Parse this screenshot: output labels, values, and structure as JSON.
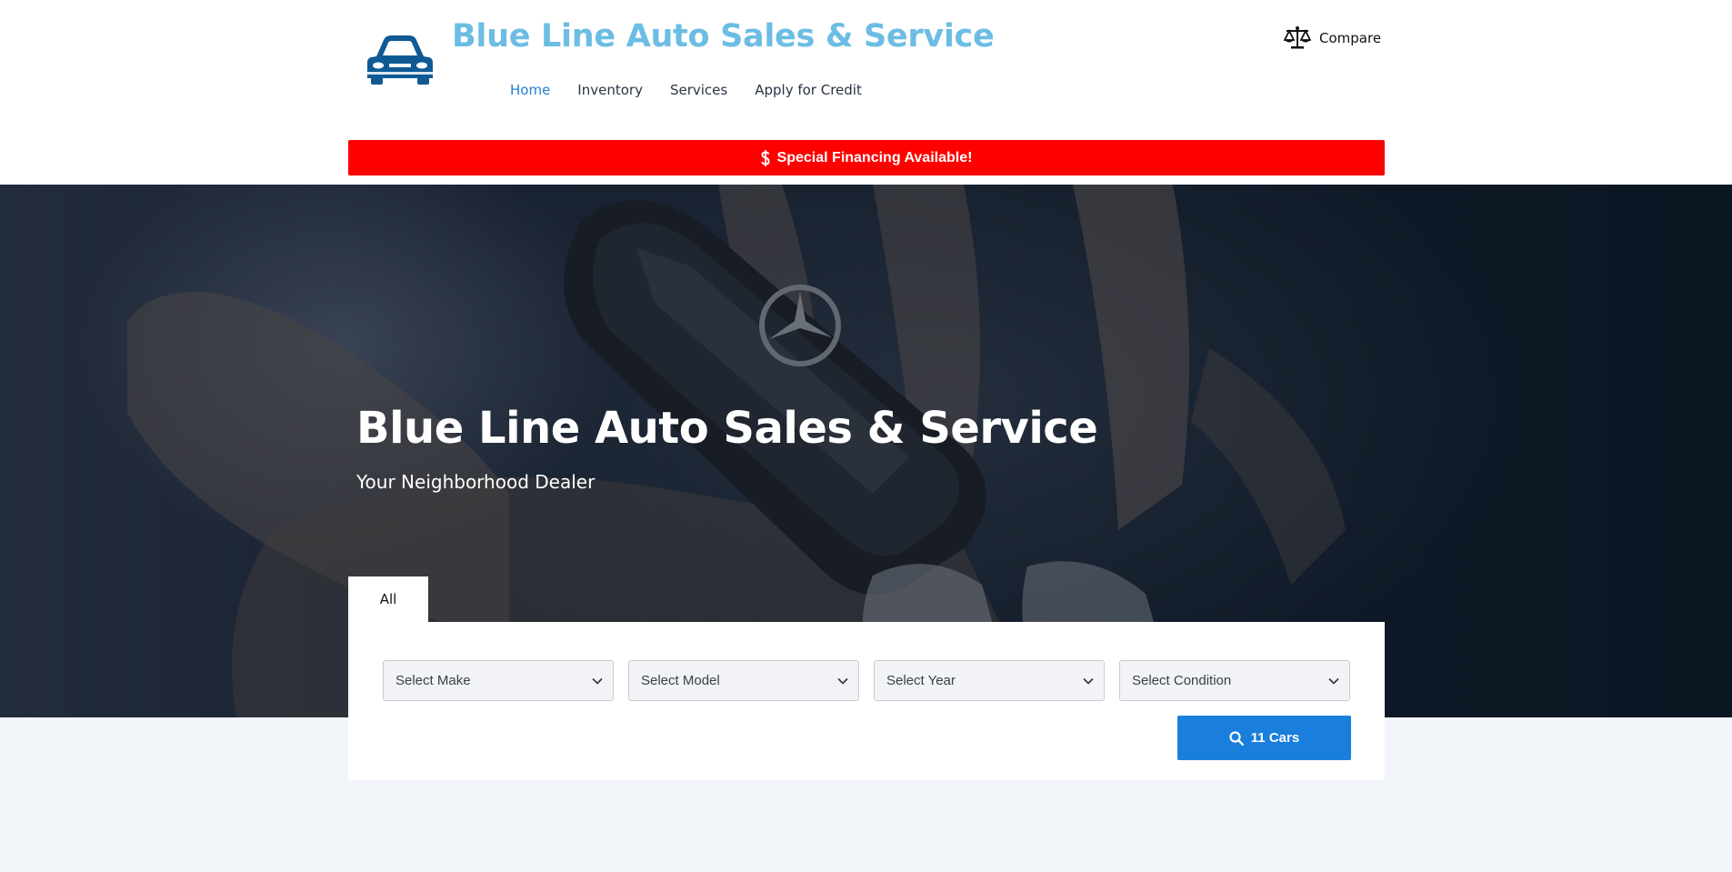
{
  "header": {
    "site_title": "Blue Line Auto Sales & Service",
    "logo_icon": "car-icon",
    "nav": [
      {
        "label": "Home",
        "active": true
      },
      {
        "label": "Inventory",
        "active": false
      },
      {
        "label": "Services",
        "active": false
      },
      {
        "label": "Apply for Credit",
        "active": false
      }
    ],
    "compare_label": "Compare",
    "compare_icon": "scale-icon"
  },
  "promo": {
    "icon": "dollar-icon",
    "text": "Special Financing Available!",
    "color": "#ff0000"
  },
  "hero": {
    "title": "Blue Line Auto Sales & Service",
    "subtitle": "Your Neighborhood Dealer"
  },
  "search": {
    "tabs": [
      {
        "label": "All",
        "active": true
      }
    ],
    "selects": {
      "make": "Select Make",
      "model": "Select Model",
      "year": "Select Year",
      "condition": "Select Condition"
    },
    "button_label": "11 Cars",
    "button_icon": "search-icon"
  },
  "colors": {
    "title_blue": "#6cbde3",
    "nav_active": "#1f7fd1",
    "logo_blue": "#0f5a94",
    "button_blue": "#1a7fdc"
  }
}
